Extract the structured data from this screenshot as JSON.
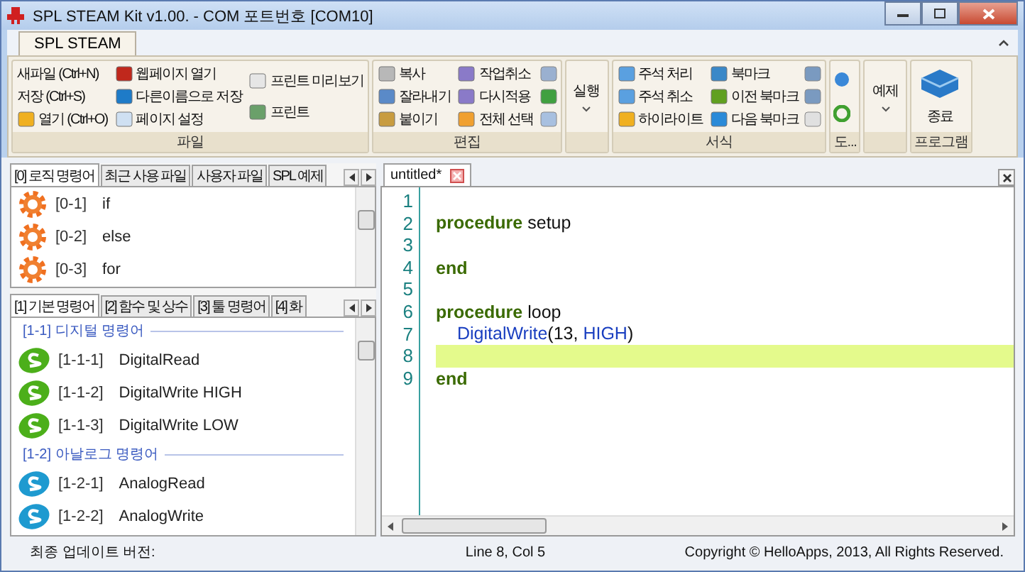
{
  "window": {
    "title": "SPL STEAM Kit v1.00.  - COM 포트번호 [COM10]"
  },
  "ribbon_tabs": [
    {
      "label": "SPL STEAM",
      "selected": true
    }
  ],
  "ribbon_groups": [
    {
      "label": "파일",
      "kind": "small",
      "columns": [
        [
          "새파일 (Ctrl+N)",
          "저장 (Ctrl+S)",
          "열기 (Ctrl+O)"
        ],
        [
          "웹페이지 열기",
          "다른이름으로 저장",
          "페이지 설정"
        ],
        [
          "프린트 미리보기",
          "프린트"
        ]
      ]
    },
    {
      "label": "편집",
      "kind": "small",
      "columns": [
        [
          "복사",
          "잘라내기",
          "붙이기"
        ],
        [
          "작업취소",
          "다시적용",
          "전체 선택"
        ]
      ]
    },
    {
      "kind": "large",
      "button": "실행"
    },
    {
      "label": "서식",
      "kind": "small",
      "columns": [
        [
          "주석 처리",
          "주석 취소",
          "하이라이트"
        ],
        [
          "북마크",
          "이전 북마크",
          "다음 북마크"
        ]
      ]
    },
    {
      "label": "도...",
      "kind": "icons"
    },
    {
      "kind": "large",
      "button": "예제"
    },
    {
      "label": "프로그램",
      "kind": "exit",
      "button": "종료"
    }
  ],
  "left_top": {
    "tabs": [
      {
        "label": "[0] 로직 명령어",
        "selected": true
      },
      {
        "label": "최근 사용 파일",
        "selected": false
      },
      {
        "label": "사용자 파일",
        "selected": false
      },
      {
        "label": "SPL 예제",
        "selected": false
      }
    ],
    "items": [
      {
        "code": "[0-1]",
        "name": "if"
      },
      {
        "code": "[0-2]",
        "name": "else"
      },
      {
        "code": "[0-3]",
        "name": "for"
      }
    ]
  },
  "left_bottom": {
    "tabs": [
      {
        "label": "[1] 기본 명령어",
        "selected": true
      },
      {
        "label": "[2] 함수 및 상수",
        "selected": false
      },
      {
        "label": "[3] 툴 명령어",
        "selected": false
      },
      {
        "label": "[4] 화",
        "selected": false
      }
    ],
    "entries": [
      {
        "kind": "section",
        "label": "[1-1]  디지털 명령어"
      },
      {
        "kind": "item",
        "code": "[1-1-1]",
        "name": "DigitalRead",
        "color": "#4caf1a"
      },
      {
        "kind": "item",
        "code": "[1-1-2]",
        "name": "DigitalWrite HIGH",
        "color": "#4caf1a"
      },
      {
        "kind": "item",
        "code": "[1-1-3]",
        "name": "DigitalWrite LOW",
        "color": "#4caf1a"
      },
      {
        "kind": "section",
        "label": "[1-2]  아날로그 명령어"
      },
      {
        "kind": "item",
        "code": "[1-2-1]",
        "name": "AnalogRead",
        "color": "#1e9ad0"
      },
      {
        "kind": "item",
        "code": "[1-2-2]",
        "name": "AnalogWrite",
        "color": "#1e9ad0"
      }
    ]
  },
  "editor": {
    "tab": {
      "label": "untitled*",
      "selected": true
    },
    "lines": [
      {
        "number": "1",
        "current": false
      },
      {
        "number": "2",
        "current": false,
        "indented": false,
        "tokens": [
          {
            "kind": "keyword",
            "text": "procedure"
          },
          {
            "kind": "plain",
            "text": " setup"
          }
        ]
      },
      {
        "number": "3",
        "current": false
      },
      {
        "number": "4",
        "current": false,
        "indented": false,
        "tokens": [
          {
            "kind": "keyword",
            "text": "end"
          }
        ]
      },
      {
        "number": "5",
        "current": false
      },
      {
        "number": "6",
        "current": false,
        "indented": false,
        "tokens": [
          {
            "kind": "keyword",
            "text": "procedure"
          },
          {
            "kind": "plain",
            "text": " loop"
          }
        ]
      },
      {
        "number": "7",
        "current": false,
        "indented": true,
        "tokens": [
          {
            "kind": "func",
            "text": "DigitalWrite"
          },
          {
            "kind": "plain",
            "text": "(13, "
          },
          {
            "kind": "func",
            "text": "HIGH"
          },
          {
            "kind": "plain",
            "text": ")"
          }
        ]
      },
      {
        "number": "8",
        "current": true
      },
      {
        "number": "9",
        "current": false,
        "indented": false,
        "tokens": [
          {
            "kind": "keyword",
            "text": "end"
          }
        ]
      }
    ]
  },
  "status_bar": {
    "version_label": "최종 업데이트 버전:",
    "position": "Line 8, Col 5",
    "copyright": "Copyright © HelloApps, 2013, All Rights Reserved."
  }
}
